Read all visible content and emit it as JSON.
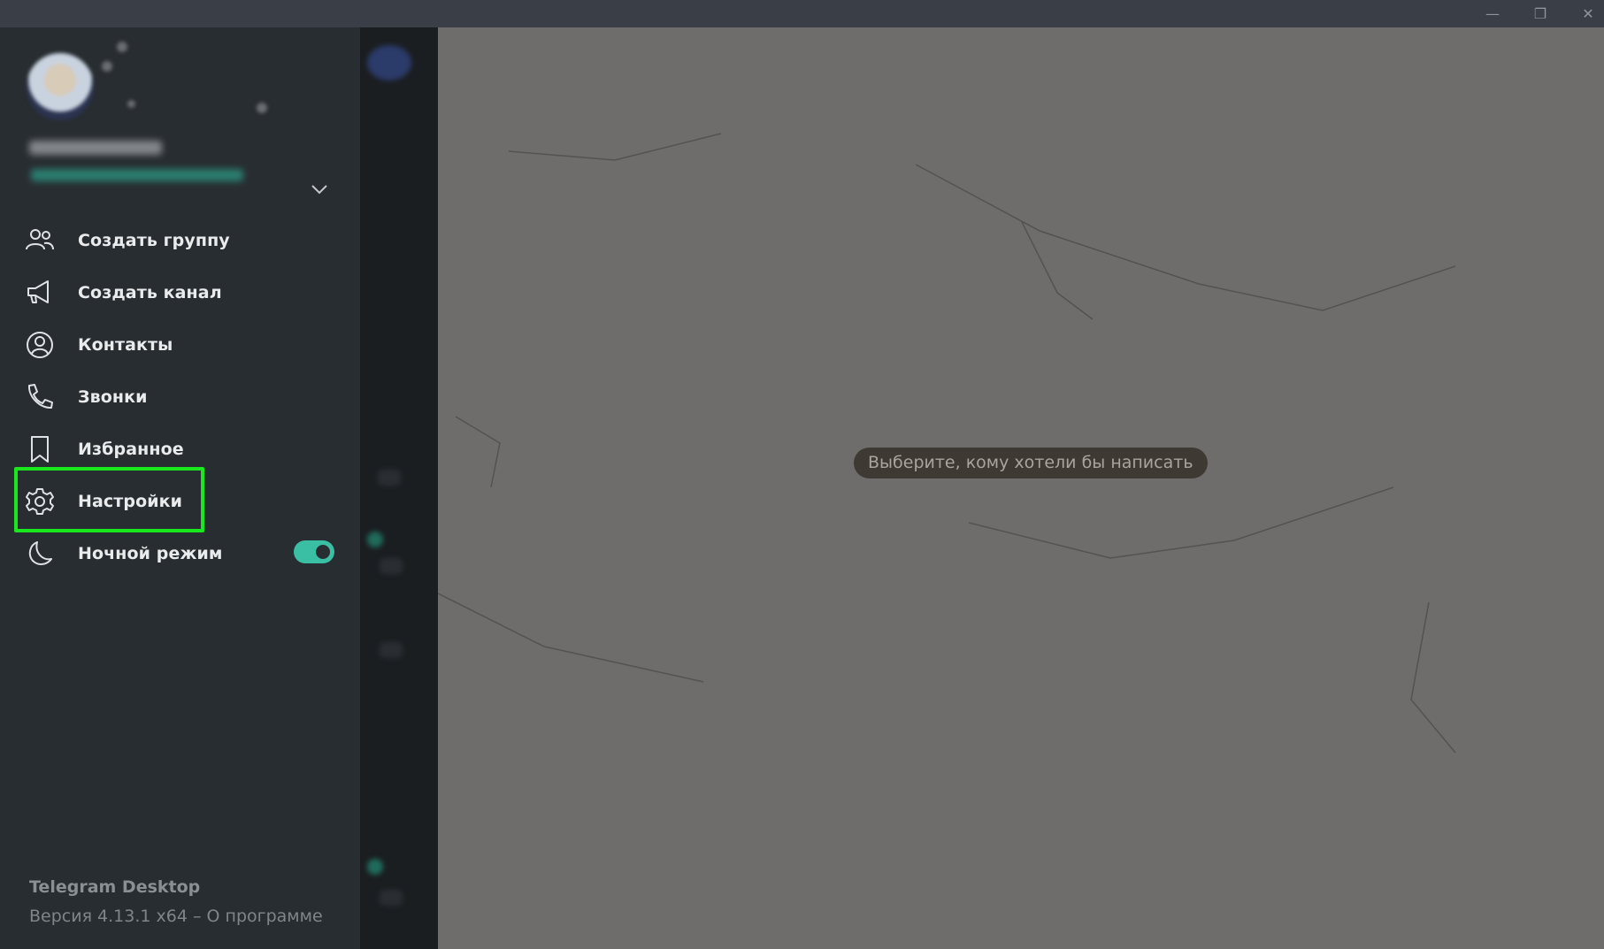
{
  "window": {
    "minimize_icon": "minimize-icon",
    "maximize_icon": "restore-icon",
    "close_icon": "close-icon"
  },
  "menu": {
    "items": [
      {
        "label": "Создать группу",
        "icon": "group-icon"
      },
      {
        "label": "Создать канал",
        "icon": "megaphone-icon"
      },
      {
        "label": "Контакты",
        "icon": "contact-icon"
      },
      {
        "label": "Звонки",
        "icon": "phone-icon"
      },
      {
        "label": "Избранное",
        "icon": "bookmark-icon"
      },
      {
        "label": "Настройки",
        "icon": "gear-icon"
      },
      {
        "label": "Ночной режим",
        "icon": "moon-icon"
      }
    ],
    "night_mode_enabled": true,
    "highlight_color": "#19e81c",
    "accent_color": "#3bbfa4"
  },
  "footer": {
    "app_name": "Telegram Desktop",
    "version": "Версия 4.13.1 x64 – О программе"
  },
  "main": {
    "placeholder": "Выберите, кому хотели бы написать"
  }
}
